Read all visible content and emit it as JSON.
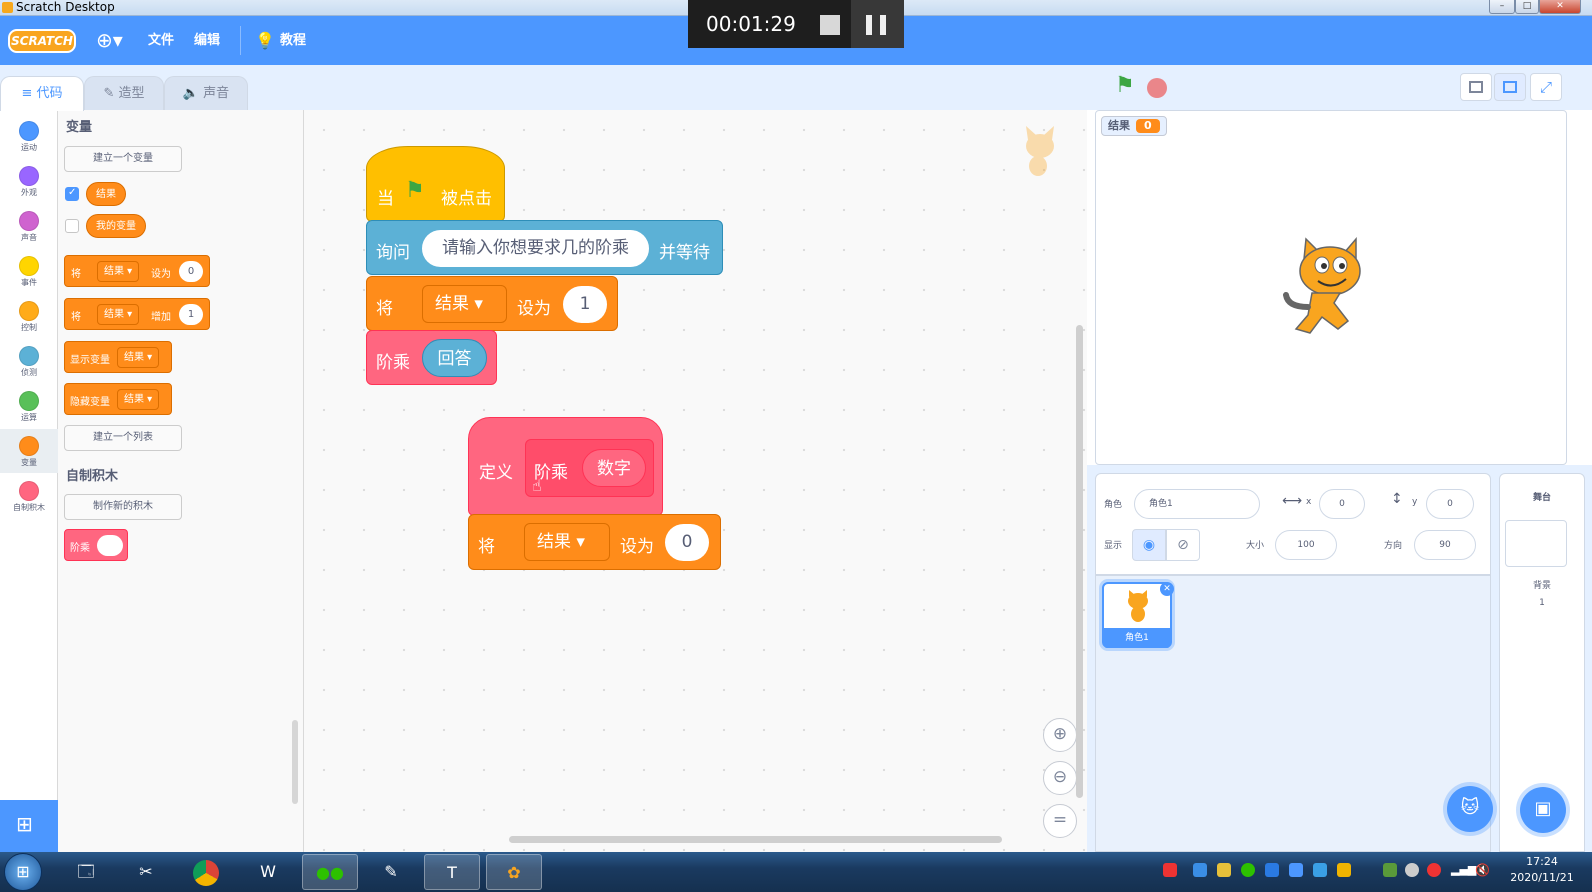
{
  "window": {
    "title": "Scratch Desktop"
  },
  "recorder": {
    "time": "00:01:29"
  },
  "menu": {
    "logo": "SCRATCH",
    "file": "文件",
    "edit": "编辑",
    "tutorials": "教程"
  },
  "tabs": [
    {
      "label": "代码"
    },
    {
      "label": "造型"
    },
    {
      "label": "声音"
    }
  ],
  "categories": [
    {
      "label": "运动",
      "color": "#4c97ff"
    },
    {
      "label": "外观",
      "color": "#9966ff"
    },
    {
      "label": "声音",
      "color": "#cf63cf"
    },
    {
      "label": "事件",
      "color": "#ffd500"
    },
    {
      "label": "控制",
      "color": "#ffab19"
    },
    {
      "label": "侦测",
      "color": "#5cb1d6"
    },
    {
      "label": "运算",
      "color": "#59c059"
    },
    {
      "label": "变量",
      "color": "#ff8c1a"
    },
    {
      "label": "自制积木",
      "color": "#ff6680"
    }
  ],
  "palette": {
    "variables_heading": "变量",
    "make_variable": "建立一个变量",
    "var_result": "结果",
    "var_my": "我的变量",
    "set_label": "将",
    "set_to": "设为",
    "set_value": "0",
    "change_by": "增加",
    "change_value": "1",
    "show_var": "显示变量",
    "hide_var": "隐藏变量",
    "make_list": "建立一个列表",
    "myblocks_heading": "自制积木",
    "make_block": "制作新的积木",
    "custom_block": "阶乘"
  },
  "script1": {
    "when": "当",
    "clicked": "被点击",
    "ask": "询问",
    "ask_text": "请输入你想要求几的阶乘",
    "and_wait": "并等待",
    "set": "将",
    "var": "结果",
    "set_to": "设为",
    "value": "1",
    "call": "阶乘",
    "answer": "回答"
  },
  "script2": {
    "define": "定义",
    "name": "阶乘",
    "param": "数字",
    "set": "将",
    "var": "结果",
    "set_to": "设为",
    "value": "0"
  },
  "zoom": {
    "reset": "="
  },
  "stage": {
    "monitor_label": "结果",
    "monitor_value": "0"
  },
  "sprite_info": {
    "sprite_label": "角色",
    "sprite_name": "角色1",
    "x_label": "x",
    "x": "0",
    "y_label": "y",
    "y": "0",
    "show_label": "显示",
    "size_label": "大小",
    "size": "100",
    "direction_label": "方向",
    "direction": "90"
  },
  "sprites": [
    {
      "name": "角色1"
    }
  ],
  "stage_panel": {
    "title": "舞台",
    "backdrops_label": "背景",
    "backdrops_count": "1"
  },
  "taskbar": {
    "time": "17:24",
    "date": "2020/11/21"
  }
}
